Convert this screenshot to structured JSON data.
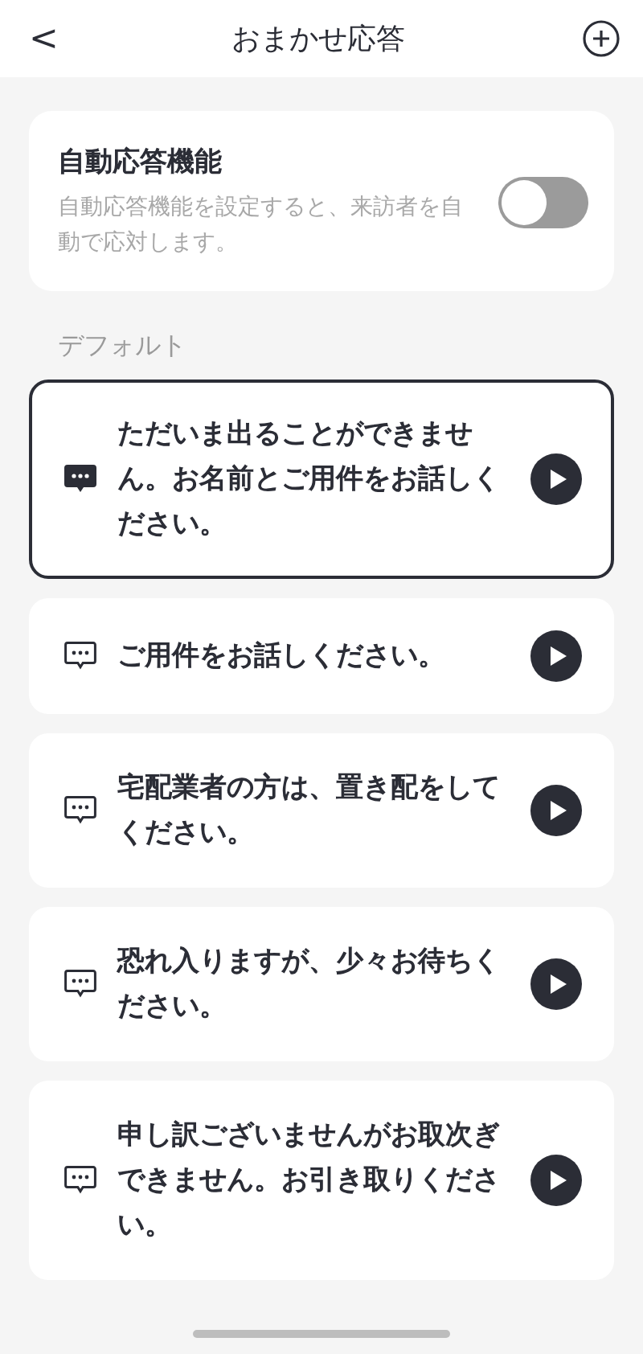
{
  "header": {
    "back": "<",
    "title": "おまかせ応答"
  },
  "auto_response": {
    "title": "自動応答機能",
    "description": "自動応答機能を設定すると、来訪者を自動で応対します。",
    "on": false
  },
  "section_label": "デフォルト",
  "messages": [
    {
      "text": "ただいま出ることができません。お名前とご用件をお話しください。",
      "selected": true
    },
    {
      "text": "ご用件をお話しください。",
      "selected": false
    },
    {
      "text": "宅配業者の方は、置き配をしてください。",
      "selected": false
    },
    {
      "text": "恐れ入りますが、少々お待ちください。",
      "selected": false
    },
    {
      "text": "申し訳ございませんがお取次ぎできません。お引き取りください。",
      "selected": false
    }
  ]
}
